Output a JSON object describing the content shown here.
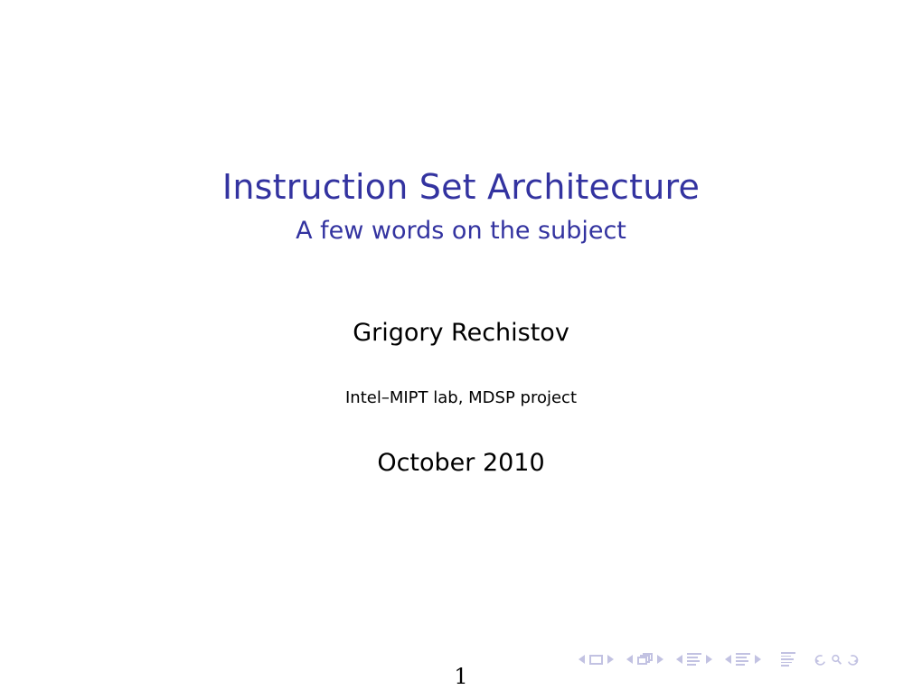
{
  "slide": {
    "title": "Instruction Set Architecture",
    "subtitle": "A few words on the subject",
    "author": "Grigory Rechistov",
    "institute": "Intel–MIPT lab, MDSP project",
    "date": "October 2010",
    "page_number": "1",
    "colors": {
      "title": "#3333a0",
      "text": "#000000",
      "navigation": "#c2c2e2",
      "background": "#ffffff"
    }
  },
  "navigation": {
    "groups": [
      {
        "name": "slide",
        "prev_label": "previous-slide",
        "icon": "slide-icon",
        "next_label": "next-slide"
      },
      {
        "name": "frame",
        "prev_label": "previous-frame",
        "icon": "frame-icon",
        "next_label": "next-frame"
      },
      {
        "name": "subsection",
        "prev_label": "previous-subsection",
        "icon": "subsection-icon",
        "next_label": "next-subsection"
      },
      {
        "name": "section",
        "prev_label": "previous-section",
        "icon": "section-icon",
        "next_label": "next-section"
      }
    ],
    "presentation_icon": "presentation-icon",
    "back_icon": "back-arrow-icon",
    "search_icon": "search-icon",
    "forward_icon": "forward-arrow-icon"
  }
}
